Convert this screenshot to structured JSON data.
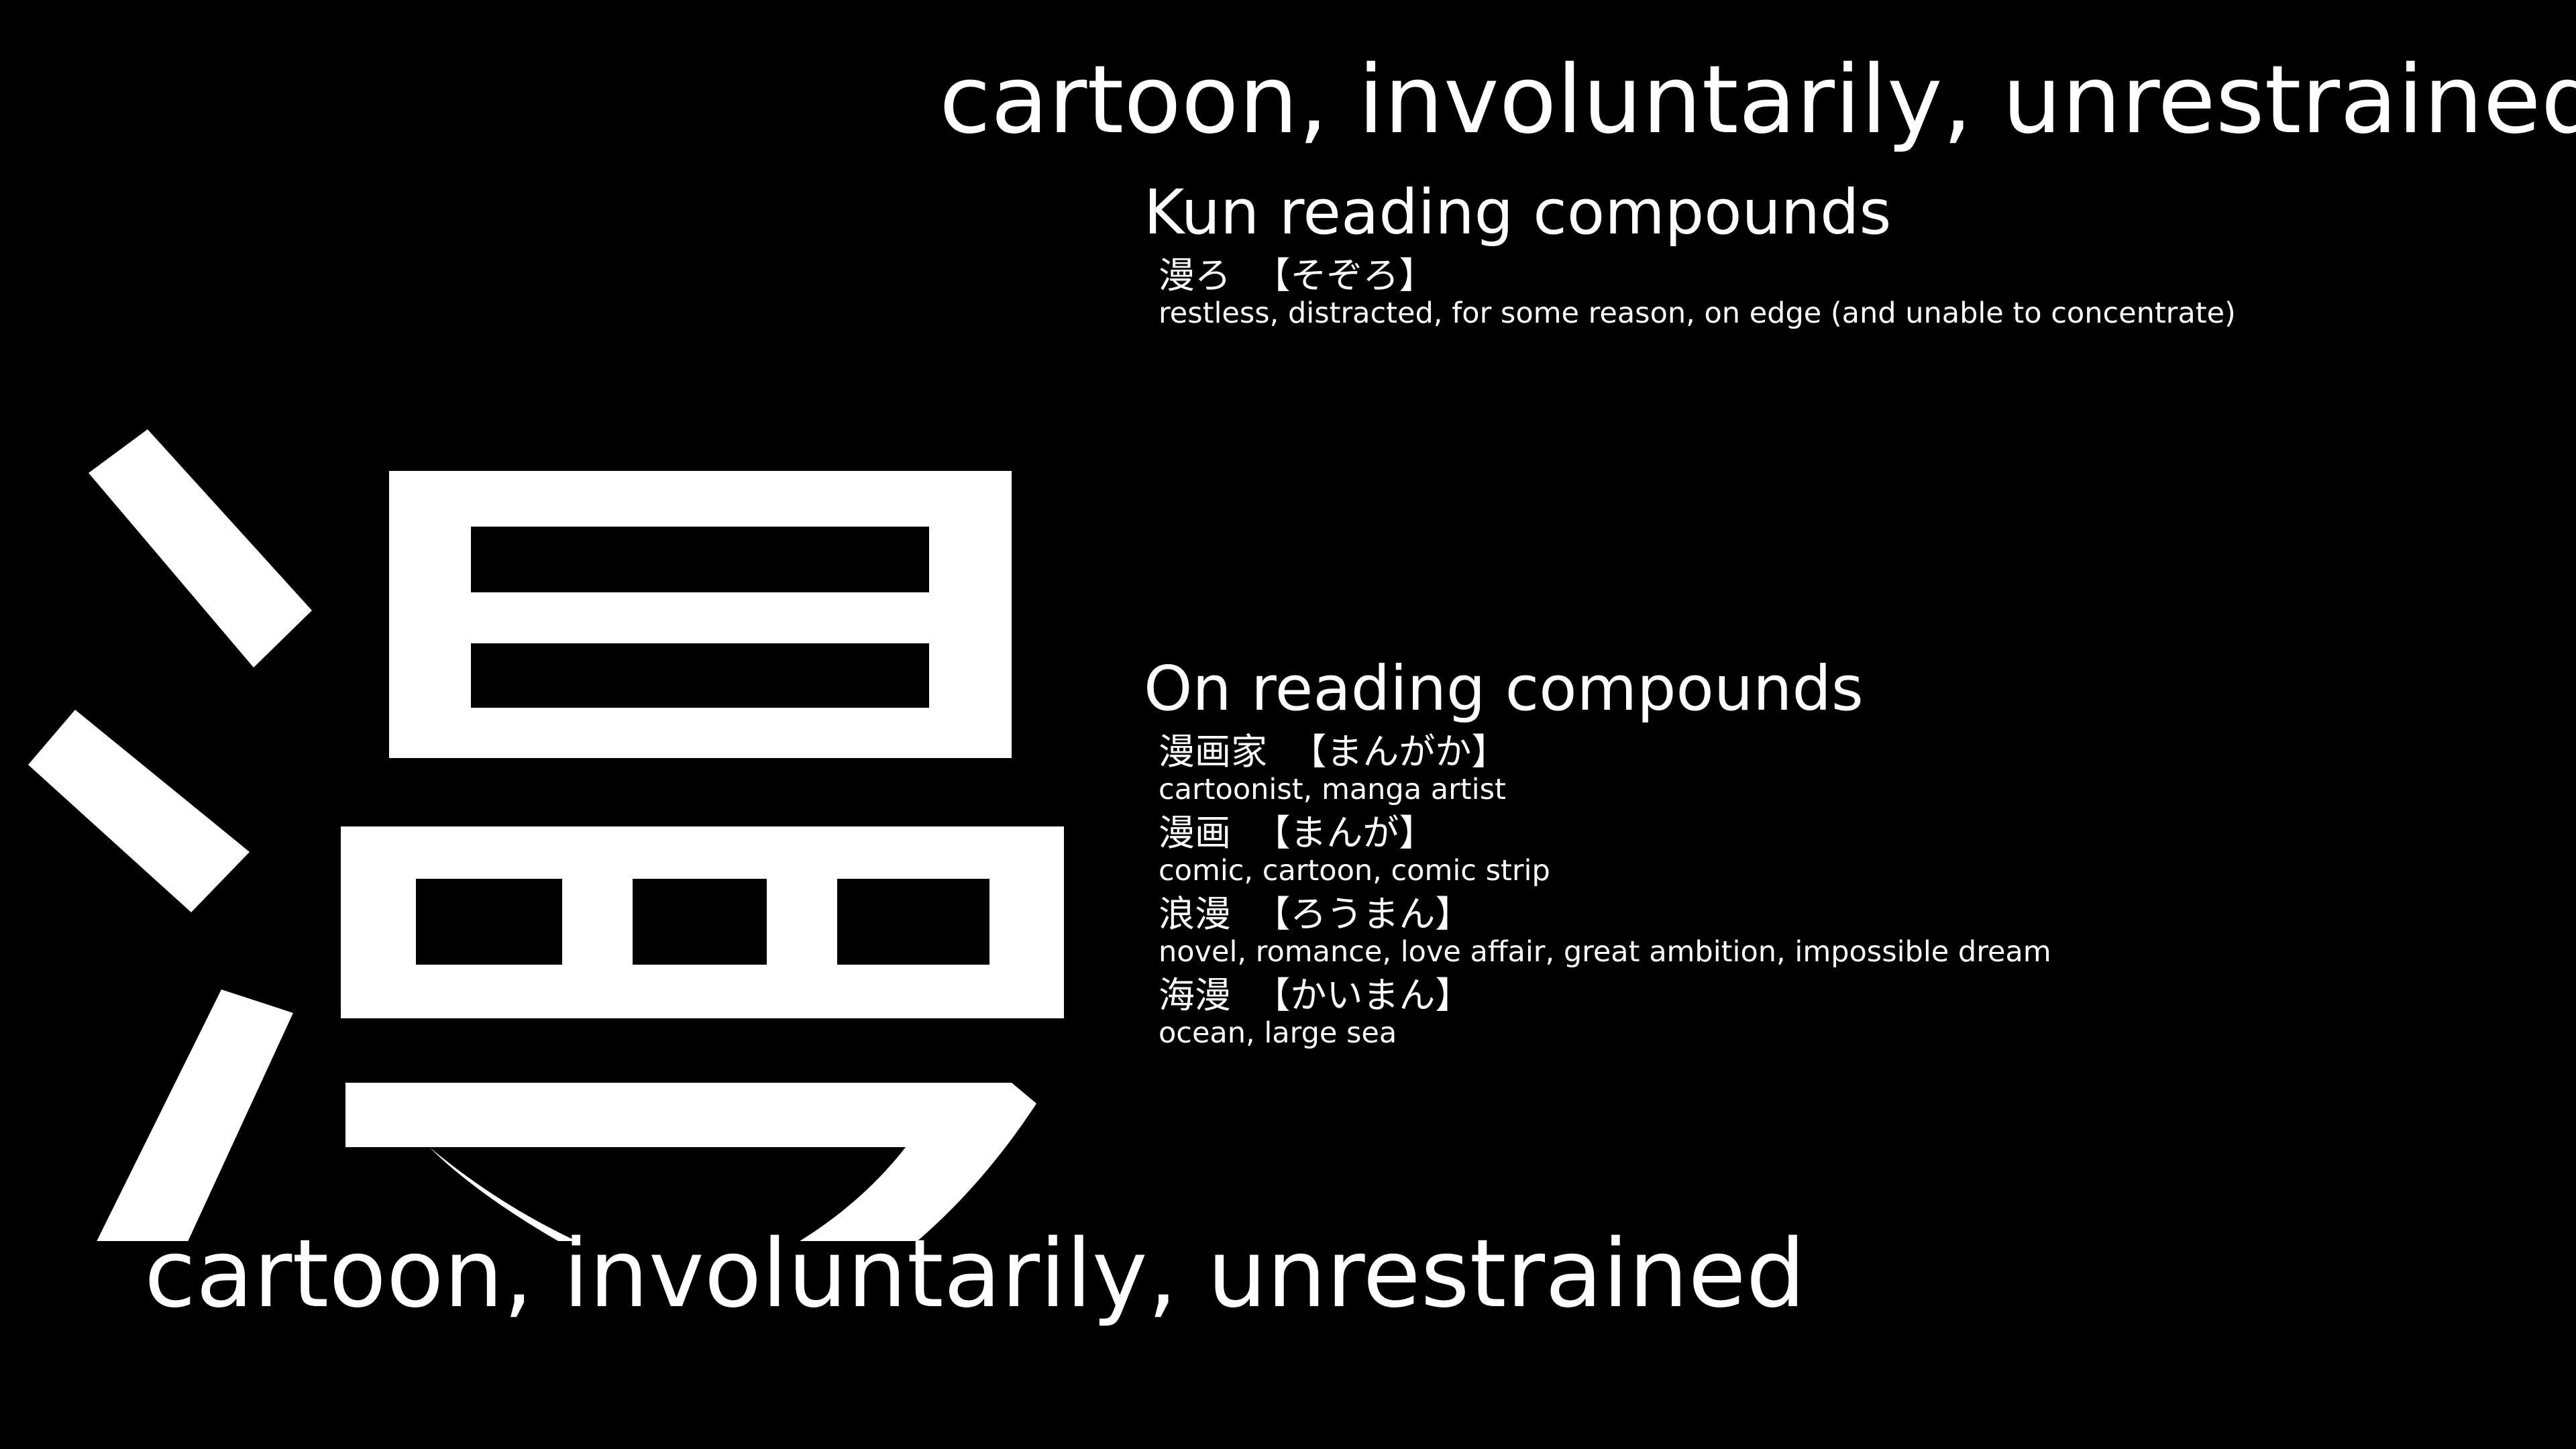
{
  "kanji": {
    "character": "漫",
    "color": "#ffffff",
    "background": "#000000"
  },
  "meaning_top": "cartoon, involuntarily, unrestrained",
  "meaning_bottom": "cartoon, involuntarily, unrestrained",
  "kun": {
    "heading": "Kun reading compounds",
    "items": [
      {
        "word": "漫ろ",
        "reading": "【そぞろ】",
        "gloss": "restless, distracted, for some reason, on edge (and unable to concentrate)"
      }
    ]
  },
  "on": {
    "heading": "On reading compounds",
    "items": [
      {
        "word": "漫画家",
        "reading": "【まんがか】",
        "gloss": "cartoonist, manga artist"
      },
      {
        "word": "漫画",
        "reading": "【まんが】",
        "gloss": "comic, cartoon, comic strip"
      },
      {
        "word": "浪漫",
        "reading": "【ろうまん】",
        "gloss": "novel, romance, love affair, great ambition, impossible dream"
      },
      {
        "word": "海漫",
        "reading": "【かいまん】",
        "gloss": "ocean, large sea"
      }
    ]
  }
}
